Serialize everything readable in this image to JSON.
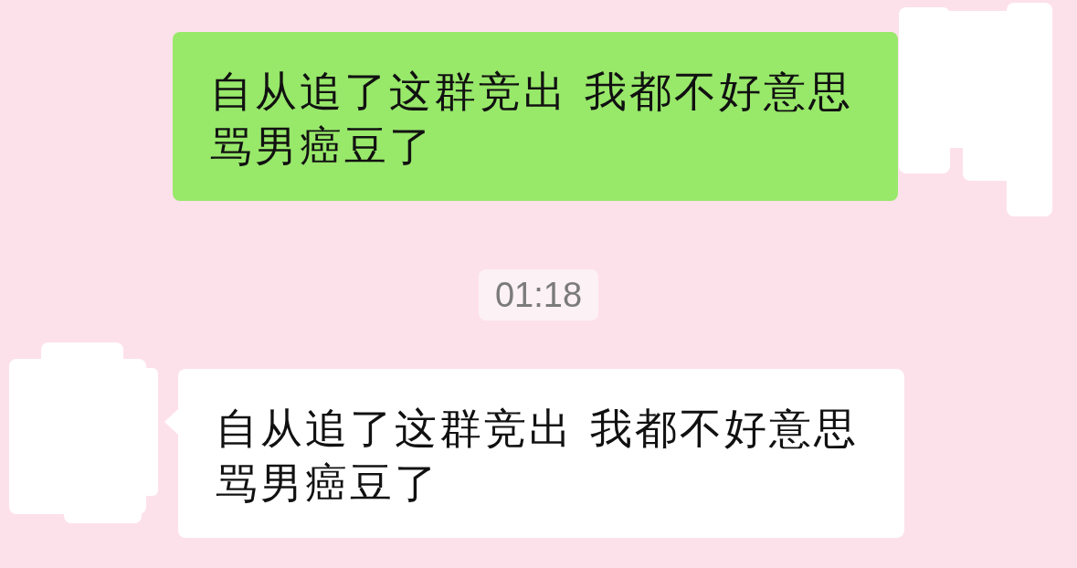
{
  "messages": [
    {
      "kind": "sent",
      "text": "自从追了这群竞出 我都不好意思骂男癌豆了"
    },
    {
      "kind": "timestamp",
      "text": "01:18"
    },
    {
      "kind": "received",
      "text": "自从追了这群竞出 我都不好意思骂男癌豆了"
    }
  ]
}
